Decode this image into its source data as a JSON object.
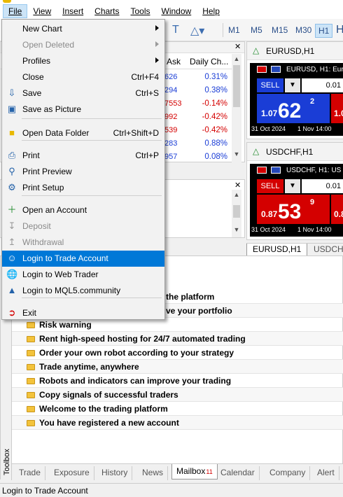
{
  "menubar": [
    "File",
    "View",
    "Insert",
    "Charts",
    "Tools",
    "Window",
    "Help"
  ],
  "toolbar": {
    "timeframes": [
      "M1",
      "M5",
      "M15",
      "M30",
      "H1"
    ],
    "active_timeframe": "H1"
  },
  "market_watch": {
    "columns": {
      "ask": "Ask",
      "daily_change": "Daily Ch..."
    },
    "rows": [
      {
        "ask": "626",
        "change": "0.31%",
        "dir": "pos"
      },
      {
        "ask": "294",
        "change": "0.38%",
        "dir": "pos"
      },
      {
        "ask": "7553",
        "change": "-0.14%",
        "dir": "neg"
      },
      {
        "ask": "992",
        "change": "-0.42%",
        "dir": "neg"
      },
      {
        "ask": "539",
        "change": "-0.42%",
        "dir": "neg"
      },
      {
        "ask": "283",
        "change": "0.88%",
        "dir": "pos"
      },
      {
        "ask": "957",
        "change": "0.08%",
        "dir": "pos"
      }
    ]
  },
  "charts": [
    {
      "name": "EURUSD,H1",
      "header": "EURUSD, H1: Eur",
      "sell": "SELL",
      "lot": "0.01",
      "small": "1.07",
      "big": "62",
      "sup": "2",
      "right": "1.0",
      "date1": "31 Oct 2024",
      "date2": "1 Nov 14:00"
    },
    {
      "name": "USDCHF,H1",
      "header": "USDCHF, H1: US",
      "sell": "SELL",
      "lot": "0.01",
      "small": "0.87",
      "big": "53",
      "sup": "9",
      "right": "0.8",
      "date1": "31 Oct 2024",
      "date2": "1 Nov 14:00"
    }
  ],
  "chart_tabs": [
    "EURUSD,H1",
    "USDCHF"
  ],
  "file_menu": [
    {
      "label": "New Chart",
      "shortcut": "",
      "icon": "",
      "submenu": true
    },
    {
      "label": "Open Deleted",
      "shortcut": "",
      "icon": "",
      "submenu": true,
      "disabled": true
    },
    {
      "label": "Profiles",
      "shortcut": "",
      "icon": "",
      "submenu": true
    },
    {
      "label": "Close",
      "shortcut": "Ctrl+F4",
      "icon": ""
    },
    {
      "label": "Save",
      "shortcut": "Ctrl+S",
      "icon": "download-icon"
    },
    {
      "label": "Save as Picture",
      "shortcut": "",
      "icon": "picture-icon"
    },
    {
      "label": "Open Data Folder",
      "shortcut": "Ctrl+Shift+D",
      "icon": "folder-icon"
    },
    {
      "label": "Print",
      "shortcut": "Ctrl+P",
      "icon": "printer-icon"
    },
    {
      "label": "Print Preview",
      "shortcut": "",
      "icon": "print-preview-icon"
    },
    {
      "label": "Print Setup",
      "shortcut": "",
      "icon": "print-setup-icon"
    },
    {
      "label": "Open an Account",
      "shortcut": "",
      "icon": "plus-icon"
    },
    {
      "label": "Deposit",
      "shortcut": "",
      "icon": "deposit-icon",
      "disabled": true
    },
    {
      "label": "Withdrawal",
      "shortcut": "",
      "icon": "withdrawal-icon",
      "disabled": true
    },
    {
      "label": "Login to Trade Account",
      "shortcut": "",
      "icon": "user-login-icon",
      "highlighted": true
    },
    {
      "label": "Login to Web Trader",
      "shortcut": "",
      "icon": "globe-icon"
    },
    {
      "label": "Login to MQL5.community",
      "shortcut": "",
      "icon": "graduation-cap-icon"
    },
    {
      "label": "Exit",
      "shortcut": "",
      "icon": "exit-icon"
    }
  ],
  "mailbox": {
    "partial_rows": [
      "the platform",
      "ve your portfolio"
    ],
    "messages": [
      "Risk warning",
      "Rent high-speed hosting for 24/7 automated trading",
      "Order your own robot according to your strategy",
      "Trade anytime, anywhere",
      "Robots and indicators can improve your trading",
      "Copy signals of successful traders",
      "Welcome to the trading platform",
      "You have registered a new account"
    ]
  },
  "toolbox": {
    "side_label": "Toolbox",
    "tabs": [
      "Trade",
      "Exposure",
      "History",
      "News",
      "Mailbox",
      "Calendar",
      "Company",
      "Alert"
    ],
    "active_tab": "Mailbox",
    "mailbox_badge": "11"
  },
  "status": "Login to Trade Account",
  "colors": {
    "highlight": "#0078d7",
    "sell": "#d40000",
    "buy": "#1a3dd6",
    "envelope": "#f3c33b"
  }
}
